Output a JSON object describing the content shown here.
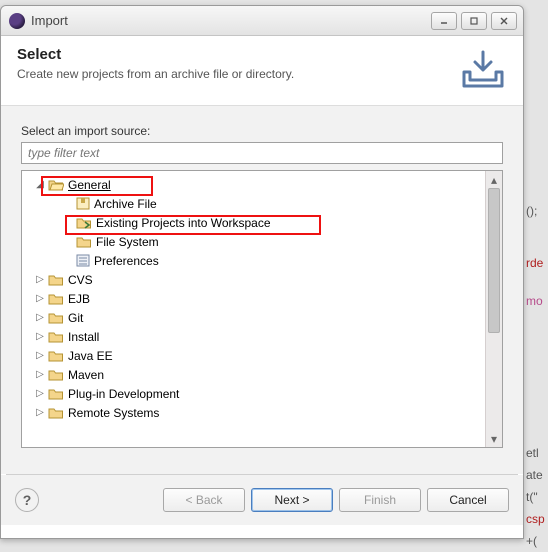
{
  "window": {
    "title": "Import"
  },
  "banner": {
    "title": "Select",
    "subtitle": "Create new projects from an archive file or directory."
  },
  "body": {
    "label": "Select an import source:",
    "filter_placeholder": "type filter text"
  },
  "tree": {
    "general": {
      "label": "General",
      "items": [
        "Archive File",
        "Existing Projects into Workspace",
        "File System",
        "Preferences"
      ]
    },
    "others": [
      "CVS",
      "EJB",
      "Git",
      "Install",
      "Java EE",
      "Maven",
      "Plug-in Development",
      "Remote Systems"
    ]
  },
  "footer": {
    "back": "< Back",
    "next": "Next >",
    "finish": "Finish",
    "cancel": "Cancel"
  },
  "bg": {
    "a": "();",
    "b": "rde",
    "c": "mo",
    "d": "etl",
    "e": "ate",
    "f": "t(\"",
    "g": "csp",
    "h": "+("
  }
}
